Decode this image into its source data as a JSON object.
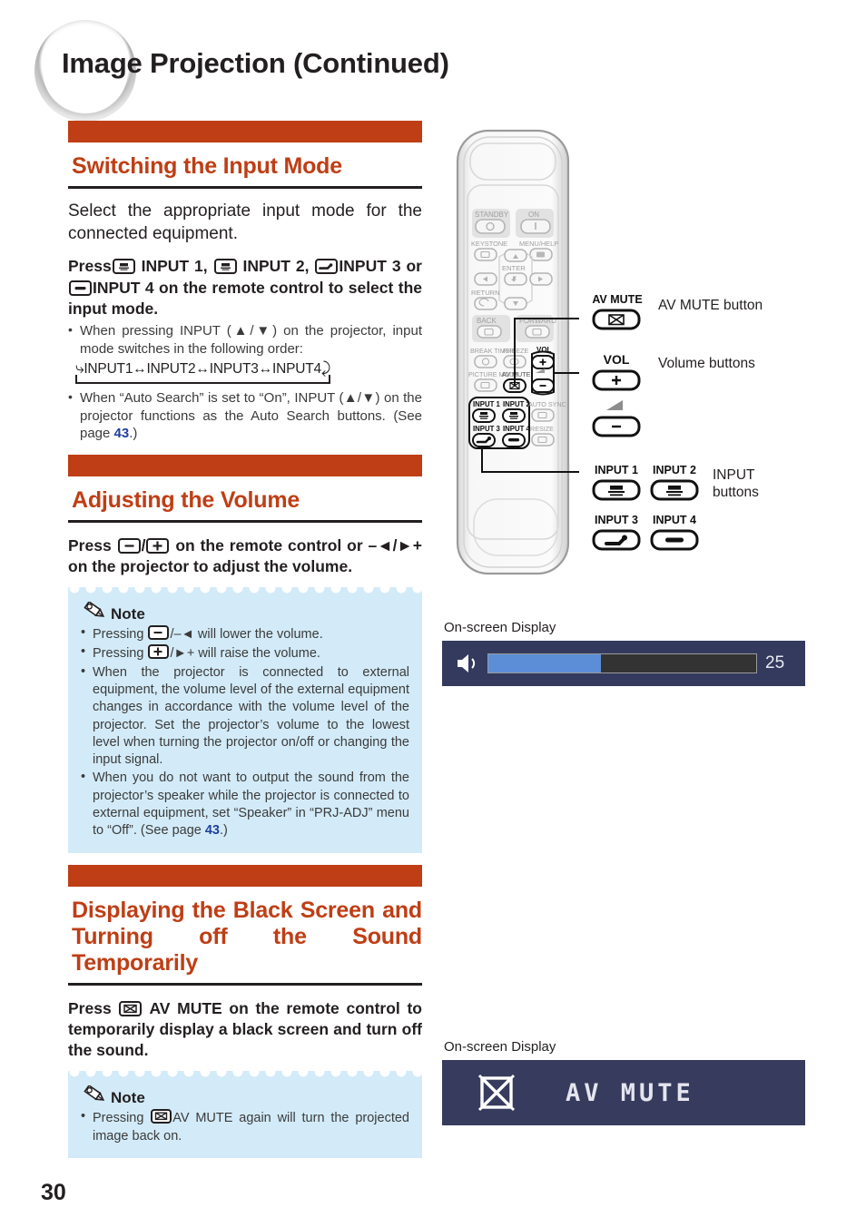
{
  "header": {
    "title": "Image Projection (Continued)"
  },
  "page_number": "30",
  "sections": [
    {
      "heading": "Switching the Input Mode",
      "lead": "Select the appropriate input mode for the connected equipment.",
      "instruction_parts": {
        "press": "Press",
        "input1": "INPUT  1,",
        "input2": "INPUT  2,",
        "input3": "INPUT 3 or",
        "input4": "INPUT 4 on the remote control to select the input mode."
      },
      "bullets": [
        "When pressing INPUT (▲/▼) on the projector, input mode switches in the following order:",
        "When “Auto Search” is set to “On”, INPUT (▲/▼) on the projector functions as the Auto Search buttons. (See page 43.)"
      ],
      "cycle_diagram": "INPUT1↔INPUT2↔INPUT3↔INPUT4",
      "bullet2_prefix": "When “Auto Search” is set to “On”, INPUT (▲/▼) on the projector functions as the Auto Search buttons. (See page ",
      "bullet2_page": "43",
      "bullet2_suffix": ".)"
    },
    {
      "heading": "Adjusting the Volume",
      "instruction_parts": {
        "press": "Press",
        "mid": "/",
        "tail": "on the remote control or –◄/►+ on the projector to adjust the volume."
      },
      "note": {
        "label": "Note",
        "items": [
          {
            "pre": "Pressing ",
            "mid": "/–◄ will lower the volume.",
            "icon": "vol-minus"
          },
          {
            "pre": "Pressing ",
            "mid": "/►+ will raise the volume.",
            "icon": "vol-plus"
          },
          {
            "text": "When the projector is connected to external equipment, the volume level of the external equipment changes in accordance with the volume level of the projector. Set the projector’s volume to the lowest level when turning the projector on/off or changing the input signal."
          },
          {
            "pre_text": "When you do not want to output the sound from the projector’s speaker while the projector is connected to external equipment, set “Speaker” in “PRJ-ADJ” menu to “Off”. (See page ",
            "page": "43",
            "post_text": ".)"
          }
        ]
      }
    },
    {
      "heading": "Displaying the Black Screen and Turning off the Sound Temporarily",
      "instruction_parts": {
        "press": "Press",
        "tail": "AV MUTE on the remote control to temporarily display a black screen and turn off the sound."
      },
      "note": {
        "label": "Note",
        "items": [
          {
            "pre": "Pressing ",
            "post": "AV MUTE again will turn the projected image back on.",
            "icon": "av-mute"
          }
        ]
      }
    }
  ],
  "remote": {
    "buttons": [
      {
        "label": "STANDBY",
        "icon": "power-standby-icon"
      },
      {
        "label": "ON",
        "icon": "power-on-icon"
      },
      {
        "label": "KEYSTONE",
        "icon": "keystone-icon"
      },
      {
        "label": "MENU/HELP",
        "icon": "menu-icon"
      },
      {
        "label": "ENTER",
        "icon": "enter-icon"
      },
      {
        "label": "RETURN",
        "icon": "return-icon"
      },
      {
        "label": "BACK",
        "icon": "back-icon"
      },
      {
        "label": "FORWARD",
        "icon": "forward-icon"
      },
      {
        "label": "BREAK TIMER",
        "icon": "break-timer-icon"
      },
      {
        "label": "FREEZE",
        "icon": "freeze-icon"
      },
      {
        "label": "PICTURE MODE",
        "icon": "picture-mode-icon"
      },
      {
        "label": "AV MUTE",
        "icon": "av-mute-icon"
      },
      {
        "label": "VOL",
        "icon": "volume-icon"
      },
      {
        "label": "INPUT 1",
        "icon": "input1-icon"
      },
      {
        "label": "INPUT 2",
        "icon": "input2-icon"
      },
      {
        "label": "INPUT 3",
        "icon": "input3-icon"
      },
      {
        "label": "INPUT 4",
        "icon": "input4-icon"
      },
      {
        "label": "AUTO SYNC",
        "icon": "auto-sync-icon"
      },
      {
        "label": "RESIZE",
        "icon": "resize-icon"
      }
    ]
  },
  "callouts": {
    "av_mute_label": "AV MUTE",
    "av_mute_text": "AV MUTE button",
    "vol_label": "VOL",
    "vol_text": "Volume buttons",
    "input1_label": "INPUT 1",
    "input2_label": "INPUT 2",
    "input3_label": "INPUT 3",
    "input4_label": "INPUT 4",
    "input_text_line1": "INPUT",
    "input_text_line2": "buttons"
  },
  "osd": {
    "caption": "On-screen Display",
    "volume": {
      "value": "25",
      "fill_percent": 42,
      "icon": "speaker-icon"
    },
    "av_mute": {
      "text": "AV MUTE",
      "icon": "av-mute-screen-icon"
    }
  },
  "colors": {
    "accent_orange": "#bf3e15",
    "note_blue": "#d3ebf8",
    "link_blue": "#1f3f9e",
    "osd_navy": "#333a5e",
    "osd_fill": "#5b8ed6"
  }
}
